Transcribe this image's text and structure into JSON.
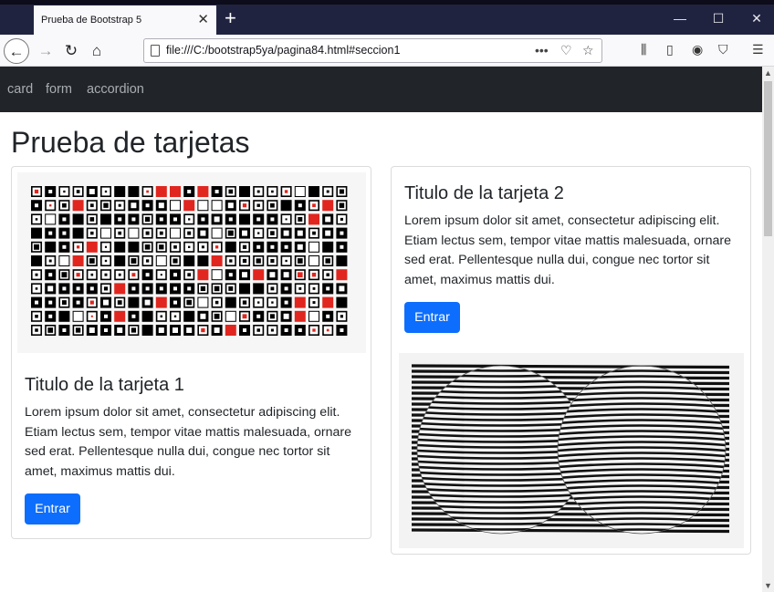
{
  "browser": {
    "tab_title": "Prueba de Bootstrap 5",
    "url": "file:///C:/bootstrap5ya/pagina84.html#seccion1"
  },
  "navbar": {
    "items": [
      {
        "label": "card"
      },
      {
        "label": "form"
      },
      {
        "label": "accordion"
      }
    ]
  },
  "page": {
    "title": "Prueba de tarjetas"
  },
  "cards": [
    {
      "title": "Titulo de la tarjeta 1",
      "text": "Lorem ipsum dolor sit amet, consectetur adipiscing elit. Etiam lectus sem, tempor vitae mattis malesuada, ornare sed erat. Pellentesque nulla dui, congue nec tortor sit amet, maximus mattis dui.",
      "button": "Entrar"
    },
    {
      "title": "Titulo de la tarjeta 2",
      "text": "Lorem ipsum dolor sit amet, consectetur adipiscing elit. Etiam lectus sem, tempor vitae mattis malesuada, ornare sed erat. Pellentesque nulla dui, congue nec tortor sit amet, maximus mattis dui.",
      "button": "Entrar"
    }
  ],
  "colors": {
    "primary": "#0d6efd",
    "navbar": "#212529",
    "accent_red": "#e0261f"
  }
}
